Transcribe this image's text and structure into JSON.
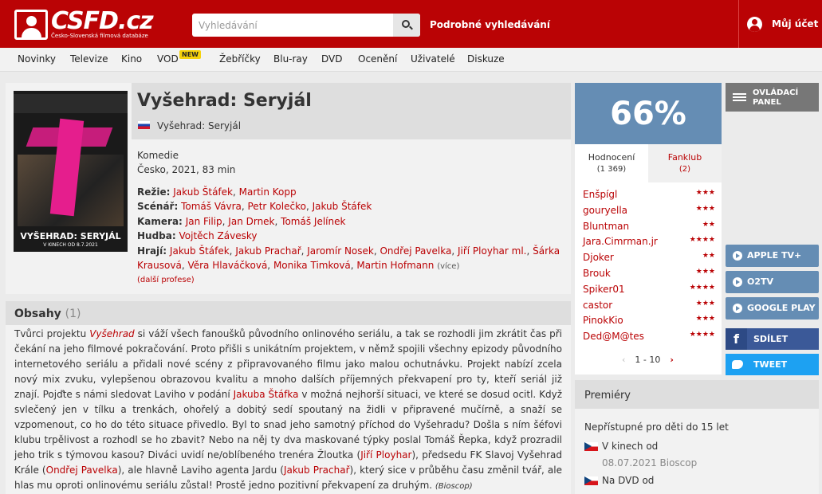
{
  "header": {
    "logo_main": "CSFD.cz",
    "logo_sub": "Česko-Slovenská filmová databáze",
    "search_placeholder": "Vyhledávání",
    "advanced_search": "Podrobné vyhledávání",
    "account": "Můj účet"
  },
  "nav": {
    "items": [
      "Novinky",
      "Televize",
      "Kino",
      "VOD",
      "Žebříčky",
      "Blu-ray",
      "DVD",
      "Ocenění",
      "Uživatelé",
      "Diskuze"
    ],
    "new_badge": "NEW"
  },
  "poster": {
    "title": "VYŠEHRAD: SERYJÁL",
    "subtitle": "V KINECH OD 8.7.2021"
  },
  "film": {
    "title": "Vyšehrad: Seryjál",
    "alt_title": "Vyšehrad: Seryjál",
    "genre": "Komedie",
    "origin": "Česko, 2021, 83 min",
    "more_professions": "(další profese)"
  },
  "credits": {
    "directing_label": "Režie:",
    "directing": [
      "Jakub Štáfek",
      "Martin Kopp"
    ],
    "screenplay_label": "Scénář:",
    "screenplay": [
      "Tomáš Vávra",
      "Petr Kolečko",
      "Jakub Štáfek"
    ],
    "camera_label": "Kamera:",
    "camera": [
      "Jan Filip",
      "Jan Drnek",
      "Tomáš Jelínek"
    ],
    "music_label": "Hudba:",
    "music": [
      "Vojtěch Závesky"
    ],
    "cast_label": "Hrají:",
    "cast": [
      "Jakub Štáfek",
      "Jakub Prachař",
      "Jaromír Nosek",
      "Ondřej Pavelka",
      "Jiří Ployhar ml.",
      "Šárka Krausová",
      "Věra Hlaváčková",
      "Monika Timková",
      "Martin Hofmann"
    ],
    "cast_more": "(více)"
  },
  "plot": {
    "title": "Obsahy",
    "count": "(1)",
    "t1": "Tvůrci projektu ",
    "l1": "Vyšehrad",
    "t2": " si váží všech fanoušků původního onlinového seriálu, a tak se rozhodli jim zkrátit čas při čekání na jeho filmové pokračování. Proto přišli s unikátním projektem, v němž spojili všechny epizody původního internetového seriálu a přidali nové scény z připravovaného filmu jako malou ochutnávku. Projekt nabízí zcela nový mix zvuku, vylepšenou obrazovou kvalitu a mnoho dalších příjemných překvapení pro ty, kteří seriál již znají. Pojďte s námi sledovat Laviho v podání ",
    "l2": "Jakuba Štáfka",
    "t3": " v možná nejhorší situaci, ve které se dosud ocitl. Když svlečený jen v tílku a trenkách, ohořelý a dobitý sedí spoutaný na židli v připravené mučírně, a snaží se vzpomenout, co ho do této situace přivedlo. Byl to snad jeho samotný příchod do Vyšehradu? Došla s ním šéfovi klubu trpělivost a rozhodl se ho zbavit? Nebo na něj ty dva maskované týpky poslal Tomáš Řepka, když prozradil jeho trik s týmovou kasou? Diváci uvidí ne/oblíbeného trenéra Žloutka (",
    "l3": "Jiří Ployhar",
    "t4": "), předsedu FK Slavoj Vyšehrad Krále (",
    "l4": "Ondřej Pavelka",
    "t5": "), ale hlavně Laviho agenta Jardu (",
    "l5": "Jakub Prachař",
    "t6": "), který sice v průběhu času změnil tvář, ale hlas mu oproti onlinovému seriálu zůstal! Prostě jedno pozitivní překvapení za druhým. ",
    "source": "(Bioscop)"
  },
  "rating": {
    "percent": "66%",
    "tab_ratings": "Hodnocení",
    "tab_ratings_count": "(1 369)",
    "tab_fanclub": "Fanklub",
    "tab_fanclub_count": "(2)",
    "users": [
      {
        "name": "Enšpígl",
        "stars": "★★★"
      },
      {
        "name": "gouryella",
        "stars": "★★★"
      },
      {
        "name": "Bluntman",
        "stars": "★★"
      },
      {
        "name": "Jara.Cimrman.jr",
        "stars": "★★★★"
      },
      {
        "name": "Djoker",
        "stars": "★★"
      },
      {
        "name": "Brouk",
        "stars": "★★★"
      },
      {
        "name": "Spiker01",
        "stars": "★★★★"
      },
      {
        "name": "castor",
        "stars": "★★★"
      },
      {
        "name": "PinokKio",
        "stars": "★★★"
      },
      {
        "name": "Ded@M@tes",
        "stars": "★★★★"
      }
    ],
    "pager": "1 - 10",
    "pager_prev": "‹",
    "pager_next": "›"
  },
  "sidebar": {
    "control_panel": "OVLÁDACÍ PANEL",
    "vod": [
      "APPLE TV+",
      "O2TV",
      "GOOGLE PLAY"
    ],
    "share_fb": "SDÍLET",
    "share_tw": "TWEET",
    "fb_glyph": "f"
  },
  "premieres": {
    "title": "Premiéry",
    "age": "Nepřístupné pro děti do 15 let",
    "cinema_label": "V kinech od",
    "cinema_date": "08.07.2021 Bioscop",
    "dvd_label": "Na DVD od"
  },
  "colors": {
    "brand_red": "#ba0305",
    "rating_blue": "#658db4",
    "facebook": "#3b5998",
    "twitter": "#1da1f2"
  }
}
